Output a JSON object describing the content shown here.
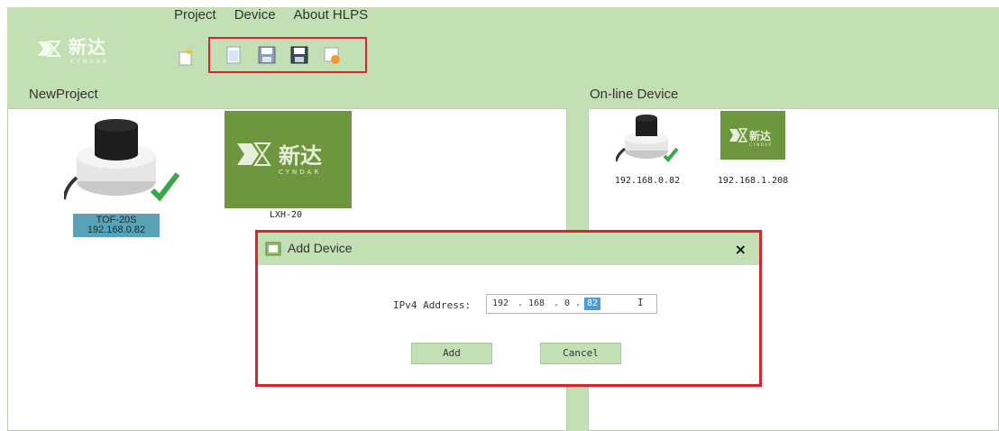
{
  "menu": [
    "Project",
    "Device",
    "About HLPS"
  ],
  "brand": {
    "name": "新达",
    "sub": "CYNDAR"
  },
  "icons": {
    "new_project": "new-project-icon",
    "toolbar": [
      "open-file-icon",
      "save-icon",
      "save-as-icon",
      "export-icon"
    ]
  },
  "project_panel": {
    "title": "NewProject",
    "devices": [
      {
        "name": "TOF-20S",
        "ip": "192.168.0.82",
        "selected": true
      },
      {
        "name": "LXH-20",
        "ip": ""
      }
    ]
  },
  "online_panel": {
    "title": "On-line Device",
    "devices": [
      {
        "ip": "192.168.0.82"
      },
      {
        "ip": "192.168.1.208"
      }
    ]
  },
  "dialog": {
    "title": "Add Device",
    "close": "×",
    "ip_label": "IPv4 Address:",
    "octets": [
      "192",
      "168",
      "0",
      "82"
    ],
    "extra": "I",
    "add": "Add",
    "cancel": "Cancel"
  },
  "colors": {
    "accent": "#c3e0b5",
    "highlight": "#d6262b",
    "tile": "#6e963e",
    "selection": "#58a3b8"
  }
}
